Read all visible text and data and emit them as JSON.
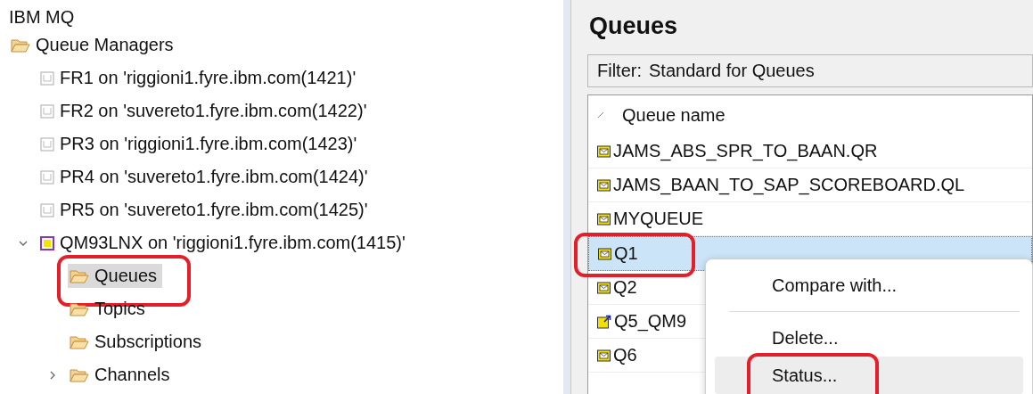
{
  "navigator": {
    "title": "IBM MQ",
    "tree": [
      {
        "label": "Queue Managers",
        "kind": "folder",
        "selected": false,
        "circled": false,
        "children": [
          {
            "label": "FR1 on 'riggioni1.fyre.ibm.com(1421)'",
            "kind": "qmgr_stopped",
            "selected": false,
            "circled": false
          },
          {
            "label": "FR2 on 'suvereto1.fyre.ibm.com(1422)'",
            "kind": "qmgr_stopped",
            "selected": false,
            "circled": false
          },
          {
            "label": "PR3 on 'riggioni1.fyre.ibm.com(1423)'",
            "kind": "qmgr_stopped",
            "selected": false,
            "circled": false
          },
          {
            "label": "PR4 on 'suvereto1.fyre.ibm.com(1424)'",
            "kind": "qmgr_stopped",
            "selected": false,
            "circled": false
          },
          {
            "label": "PR5 on 'suvereto1.fyre.ibm.com(1425)'",
            "kind": "qmgr_stopped",
            "selected": false,
            "circled": false
          },
          {
            "label": "QM93LNX on 'riggioni1.fyre.ibm.com(1415)'",
            "kind": "qmgr_running",
            "selected": false,
            "circled": false,
            "expanded": true,
            "children": [
              {
                "label": "Queues",
                "kind": "folder",
                "selected": true,
                "circled": true
              },
              {
                "label": "Topics",
                "kind": "folder",
                "selected": false,
                "circled": false
              },
              {
                "label": "Subscriptions",
                "kind": "folder",
                "selected": false,
                "circled": false
              },
              {
                "label": "Channels",
                "kind": "folder",
                "selected": false,
                "circled": false,
                "expanded": false
              }
            ]
          }
        ]
      }
    ]
  },
  "content": {
    "title": "Queues",
    "filter": {
      "label": "Filter:",
      "value": "Standard for Queues"
    },
    "table": {
      "columns": [
        "Queue name"
      ],
      "rows": [
        {
          "name": "JAMS_ABS_SPR_TO_BAAN.QR",
          "kind": "local",
          "selected": false,
          "circled": false
        },
        {
          "name": "JAMS_BAAN_TO_SAP_SCOREBOARD.QL",
          "kind": "local",
          "selected": false,
          "circled": false
        },
        {
          "name": "MYQUEUE",
          "kind": "local",
          "selected": false,
          "circled": false
        },
        {
          "name": "Q1",
          "kind": "local",
          "selected": true,
          "circled": true
        },
        {
          "name": "Q2",
          "kind": "local",
          "selected": false,
          "circled": false
        },
        {
          "name": "Q5_QM9",
          "kind": "alias",
          "selected": false,
          "circled": false
        },
        {
          "name": "Q6",
          "kind": "local",
          "selected": false,
          "circled": false
        }
      ]
    },
    "context_menu": {
      "items": [
        {
          "kind": "item",
          "label": "Compare with...",
          "selected": false,
          "circled": false
        },
        {
          "kind": "separator"
        },
        {
          "kind": "item",
          "label": "Delete...",
          "selected": false,
          "circled": false
        },
        {
          "kind": "item",
          "label": "Status...",
          "selected": true,
          "circled": true
        }
      ]
    }
  }
}
